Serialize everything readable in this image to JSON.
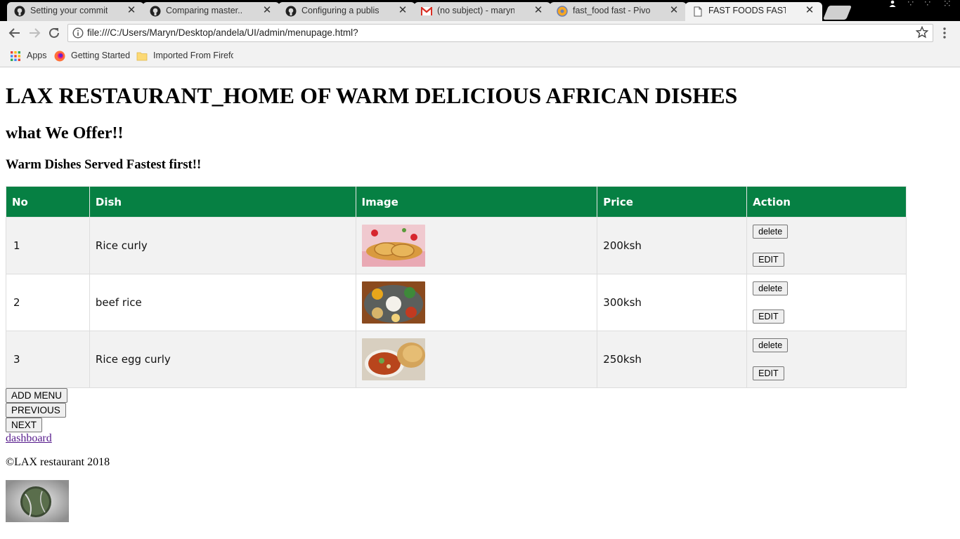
{
  "browser": {
    "tabs": [
      {
        "title": "Setting your commit ema",
        "icon": "github-icon",
        "active": false
      },
      {
        "title": "Comparing master...ft-ma",
        "icon": "github-icon",
        "active": false
      },
      {
        "title": "Configuring a publishing",
        "icon": "github-icon",
        "active": false
      },
      {
        "title": "(no subject) - marynmwir",
        "icon": "gmail-icon",
        "active": false
      },
      {
        "title": "fast_food fast - Pivotal Tr",
        "icon": "pivotal-icon",
        "active": false
      },
      {
        "title": "FAST FOODS FAST -MEN",
        "icon": "page-icon",
        "active": true
      }
    ],
    "url": "file:///C:/Users/Maryn/Desktop/andela/UI/admin/menupage.html?",
    "bookmarks": [
      {
        "label": "Apps",
        "icon": "apps-grid-icon"
      },
      {
        "label": "Getting Started",
        "icon": "firefox-icon"
      },
      {
        "label": "Imported From Firefo",
        "icon": "folder-icon"
      }
    ]
  },
  "page": {
    "heading": "LAX RESTAURANT_HOME OF WARM DELICIOUS AFRICAN DISHES",
    "subheading": "what We Offer!!",
    "tagline": "Warm Dishes Served Fastest first!!",
    "table": {
      "headers": [
        "No",
        "Dish",
        "Image",
        "Price",
        "Action"
      ],
      "rows": [
        {
          "no": "1",
          "dish": "Rice curly",
          "price": "200ksh",
          "delete_label": "delete",
          "edit_label": "EDIT"
        },
        {
          "no": "2",
          "dish": "beef rice",
          "price": "300ksh",
          "delete_label": "delete",
          "edit_label": "EDIT"
        },
        {
          "no": "3",
          "dish": "Rice egg curly",
          "price": "250ksh",
          "delete_label": "delete",
          "edit_label": "EDIT"
        }
      ]
    },
    "buttons": {
      "add_menu": "ADD MENU",
      "previous": "PREVIOUS",
      "next": "NEXT"
    },
    "dashboard_link": "dashboard",
    "footer": "©LAX restaurant 2018"
  },
  "colors": {
    "table_header": "#068043",
    "link_visited": "#551a8b"
  }
}
